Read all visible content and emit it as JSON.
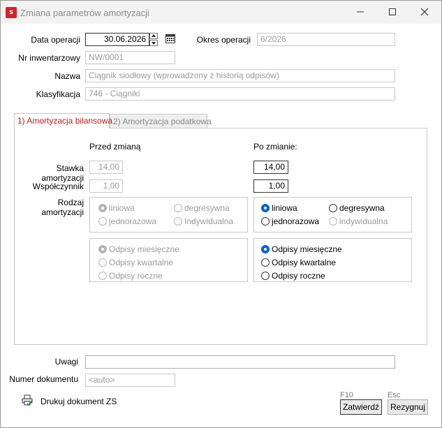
{
  "window": {
    "title": "Zmiana parametrów amortyzacji",
    "app_icon_letter": "s",
    "minimize_icon": "minimize-icon",
    "maximize_icon": "maximize-icon",
    "close_icon": "close-icon"
  },
  "form": {
    "data_operacji_label": "Data operacji",
    "data_operacji_value": "30.06.2026",
    "okres_operacji_label": "Okres operacji",
    "okres_operacji_value": "6/2026",
    "nr_inwentarzowy_label": "Nr inwentarzowy",
    "nr_inwentarzowy_value": "NW/0001",
    "nazwa_label": "Nazwa",
    "nazwa_value": "Ciągnik siodłowy (wprowadzony z historią odpisów)",
    "klasyfikacja_label": "Klasyfikacja",
    "klasyfikacja_value": "746 - Ciągniki"
  },
  "tabs": [
    {
      "label": "1) Amortyzacja bilansowa",
      "active": true
    },
    {
      "label": "2) Amortyzacja podatkowa",
      "active": false
    }
  ],
  "panel": {
    "przed_header": "Przed zmianą",
    "po_header": "Po zmianie:",
    "stawka_label": "Stawka amortyzacji",
    "wspolczynnik_label": "Współczynnik",
    "rodzaj_label": "Rodzaj amortyzacji",
    "przed": {
      "stawka": "14,00",
      "wspolczynnik": "1,00"
    },
    "po": {
      "stawka": "14,00",
      "wspolczynnik": "1,00"
    },
    "rodzaj_options": [
      "liniowa",
      "degresywna",
      "jednorazowa",
      "Indywidualna"
    ],
    "rodzaj_options_po": [
      "liniowa",
      "degresywna",
      "jednorazowa",
      "indywidualna"
    ],
    "odpisy_options": [
      "Odpisy miesięczne",
      "Odpisy kwartalne",
      "Odpisy roczne"
    ]
  },
  "bottom": {
    "uwagi_label": "Uwagi",
    "uwagi_value": "",
    "numer_label": "Numer dokumentu",
    "numer_value": "<auto>",
    "drukuj_label": "Drukuj dokument ZS",
    "zatwierdz_key": "F10",
    "zatwierdz_label": "Zatwierdź",
    "rezygnuj_key": "Esc",
    "rezygnuj_label": "Rezygnuj"
  },
  "colors": {
    "accent": "#0a5fd5",
    "active_tab": "#c31919",
    "app_icon": "#d0252b"
  }
}
